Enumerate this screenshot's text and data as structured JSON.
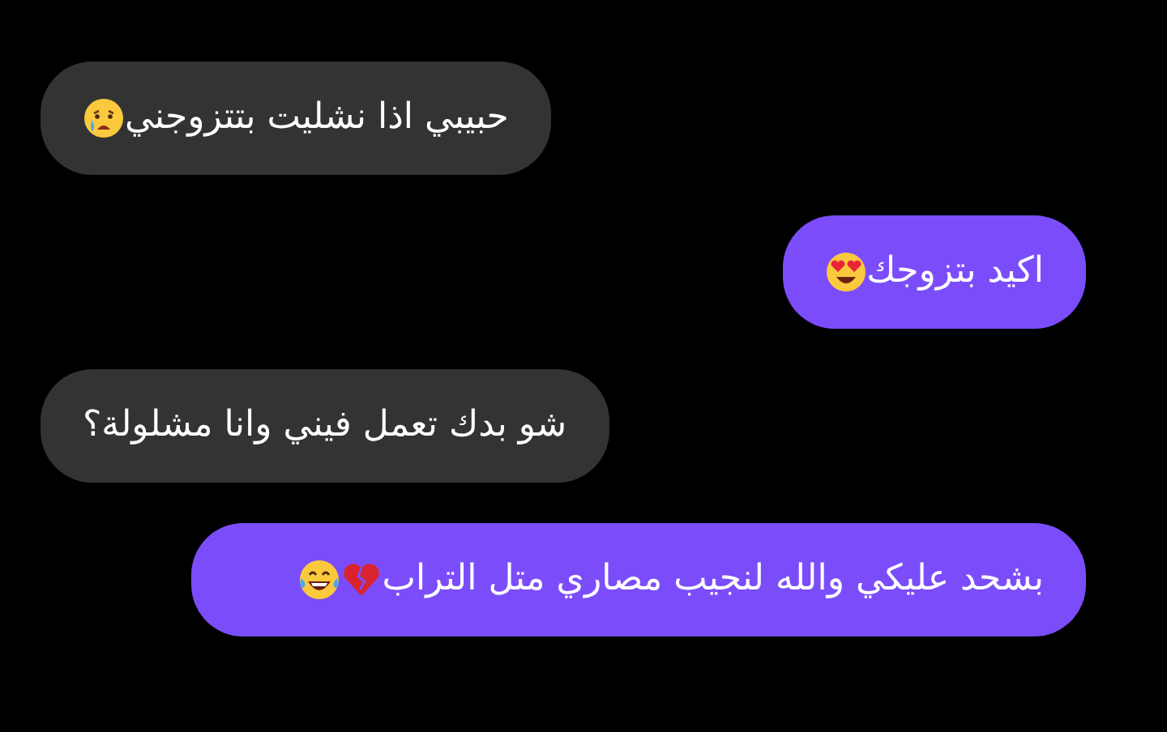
{
  "messages": [
    {
      "kind": "received",
      "text": "حبيبي اذا نشليت بتتزوجني"
    },
    {
      "kind": "sent",
      "text": "اكيد  بتزوجك"
    },
    {
      "kind": "received",
      "text": "شو بدك تعمل فيني وانا مشلولة؟"
    },
    {
      "kind": "sent",
      "text": "بشحد عليكي والله لنجيب مصاري متل التراب"
    }
  ]
}
